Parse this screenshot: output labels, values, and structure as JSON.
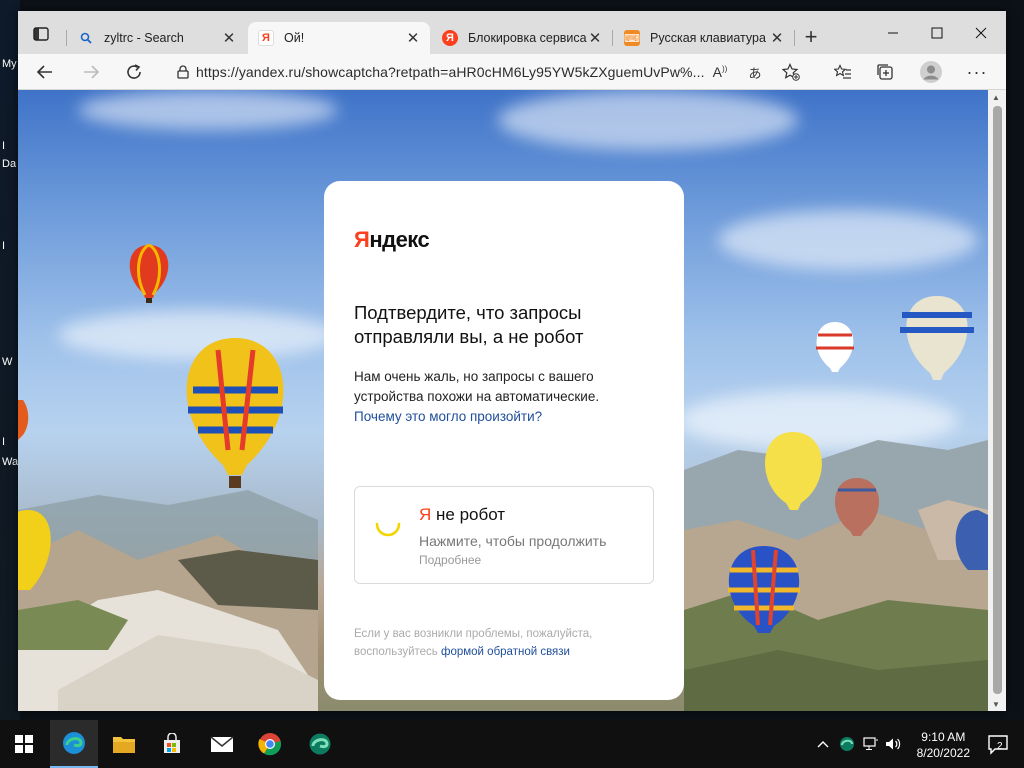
{
  "desktop": {
    "left_labels": [
      "My",
      "I",
      "Da",
      "I",
      "W",
      "I",
      "Wa"
    ]
  },
  "browser": {
    "tabs": [
      {
        "title": "zyltrc - Search",
        "icon": "search-icon"
      },
      {
        "title": "Ой!",
        "icon": "yandex-favicon",
        "active": true
      },
      {
        "title": "Блокировка сервиса",
        "icon": "yandex-favicon"
      },
      {
        "title": "Русская клавиатура",
        "icon": "keyboard-favicon"
      }
    ],
    "address": {
      "url": "https://yandex.ru/showcaptcha?retpath=aHR0cHM6Ly95YW5kZXguemUvPw%..."
    }
  },
  "captcha": {
    "logo_ya": "Я",
    "logo_rest": "ндекс",
    "heading": "Подтвердите, что запросы отправляли вы, а не робот",
    "description": "Нам очень жаль, но запросы с вашего устройства похожи на автоматические.",
    "description_link": "Почему это могло произойти?",
    "robot_ya": "Я",
    "robot_title": " не робот",
    "robot_subtitle": "Нажмите, чтобы продолжить",
    "robot_more": "Подробнее",
    "footer_text": "Если у вас возникли проблемы, пожалуйста, воспользуйтесь",
    "footer_link": "формой обратной связи",
    "colors": {
      "brand_red": "#fc3f1d",
      "link_blue": "#1f4e9b",
      "spinner_yellow": "#f5d400"
    }
  },
  "taskbar": {
    "apps": [
      "start-icon",
      "edge-icon",
      "file-explorer-icon",
      "store-icon",
      "mail-icon",
      "chrome-icon",
      "edge-dev-icon"
    ],
    "time": "9:10 AM",
    "date": "8/20/2022",
    "notification_count": "2"
  }
}
